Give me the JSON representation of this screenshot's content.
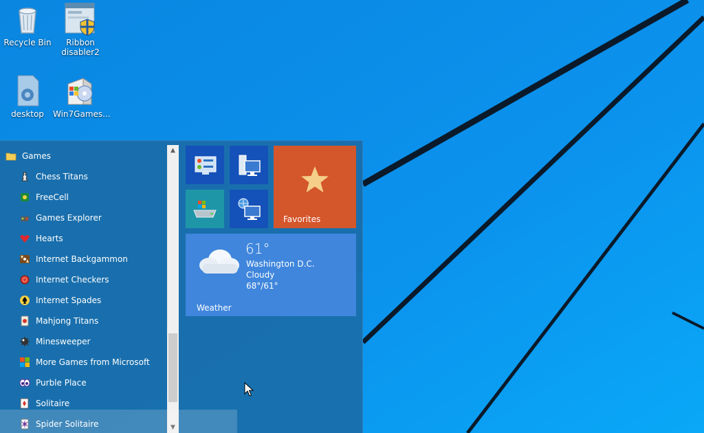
{
  "colors": {
    "desktop_blue": "#0a8be6",
    "start_menu_bg": "#1a6eaa",
    "tile_blue": "#1451b8",
    "tile_teal": "#1f96a8",
    "tile_orange": "#d4562b",
    "tile_weather": "#3f86dc"
  },
  "desktop_icons": [
    {
      "label": "Recycle Bin",
      "icon": "recycle-bin-icon"
    },
    {
      "label": "Ribbon disabler2",
      "icon": "shield-app-icon"
    },
    {
      "label": "desktop",
      "icon": "config-file-icon"
    },
    {
      "label": "Win7Games...",
      "icon": "installer-icon"
    }
  ],
  "app_list": {
    "folder": {
      "label": "Games",
      "icon": "folder-icon"
    },
    "items": [
      {
        "label": "Chess Titans",
        "icon": "chess-icon"
      },
      {
        "label": "FreeCell",
        "icon": "cards-icon"
      },
      {
        "label": "Games Explorer",
        "icon": "games-explorer-icon"
      },
      {
        "label": "Hearts",
        "icon": "hearts-icon"
      },
      {
        "label": "Internet Backgammon",
        "icon": "backgammon-icon"
      },
      {
        "label": "Internet Checkers",
        "icon": "checkers-icon"
      },
      {
        "label": "Internet Spades",
        "icon": "spades-icon"
      },
      {
        "label": "Mahjong Titans",
        "icon": "mahjong-icon"
      },
      {
        "label": "Minesweeper",
        "icon": "mine-icon"
      },
      {
        "label": "More Games from Microsoft",
        "icon": "more-games-icon"
      },
      {
        "label": "Purble Place",
        "icon": "purble-icon"
      },
      {
        "label": "Solitaire",
        "icon": "solitaire-icon"
      },
      {
        "label": "Spider Solitaire",
        "icon": "spider-icon"
      }
    ]
  },
  "scrollbar": {
    "up": "▲",
    "down": "▼"
  },
  "tiles": {
    "control_panel": {
      "icon": "control-panel-icon"
    },
    "computer": {
      "icon": "computer-icon"
    },
    "store": {
      "icon": "store-drive-icon"
    },
    "network": {
      "icon": "network-icon"
    },
    "favorites": {
      "label": "Favorites",
      "icon": "star-icon"
    },
    "weather": {
      "label": "Weather",
      "temp": "61°",
      "location": "Washington D.C.",
      "condition": "Cloudy",
      "range": "68°/61°",
      "icon": "cloud-icon"
    }
  }
}
